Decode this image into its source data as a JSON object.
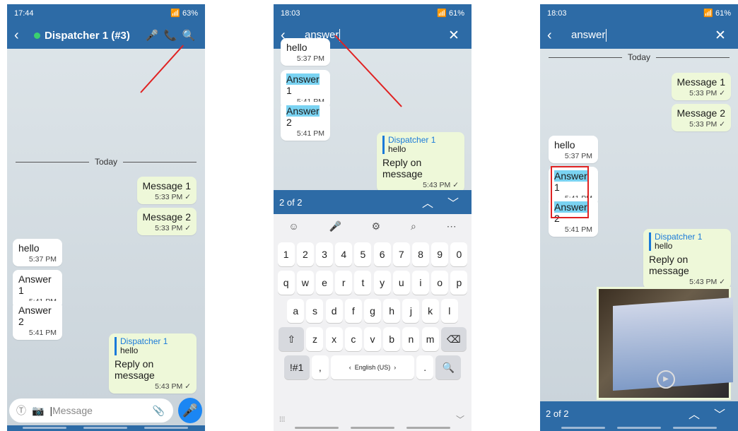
{
  "panel1": {
    "status": {
      "time": "17:44",
      "battery": "63%"
    },
    "appbar": {
      "title": "Dispatcher 1 (#3)"
    },
    "composer": {
      "placeholder": "Message"
    },
    "date_divider": "Today",
    "messages": [
      {
        "text": "Message 1",
        "time": "5:33 PM ✓"
      },
      {
        "text": "Message 2",
        "time": "5:33 PM ✓"
      },
      {
        "text": "hello",
        "time": "5:37 PM"
      },
      {
        "text": "Answer 1",
        "time": "5:41 PM"
      },
      {
        "text": "Answer 2",
        "time": "5:41 PM"
      },
      {
        "quote_name": "Dispatcher 1",
        "quote_text": "hello",
        "text": "Reply on message",
        "time": "5:43 PM ✓"
      }
    ]
  },
  "panel2": {
    "status": {
      "time": "18:03",
      "battery": "61%"
    },
    "search": {
      "query": "answer"
    },
    "messages": [
      {
        "text": "hello",
        "time": "5:37 PM"
      },
      {
        "hl": "Answer",
        "rest": " 1",
        "time": "5:41 PM"
      },
      {
        "hl": "Answer",
        "rest": " 2",
        "time": "5:41 PM"
      },
      {
        "quote_name": "Dispatcher 1",
        "quote_text": "hello",
        "text": "Reply on message",
        "time": "5:43 PM ✓"
      }
    ],
    "result_count": "2 of 2",
    "keyboard": {
      "row1": [
        "1",
        "2",
        "3",
        "4",
        "5",
        "6",
        "7",
        "8",
        "9",
        "0"
      ],
      "row2": [
        "q",
        "w",
        "e",
        "r",
        "t",
        "y",
        "u",
        "i",
        "o",
        "p"
      ],
      "row3": [
        "a",
        "s",
        "d",
        "f",
        "g",
        "h",
        "j",
        "k",
        "l"
      ],
      "row4": [
        "z",
        "x",
        "c",
        "v",
        "b",
        "n",
        "m"
      ],
      "sym": "!#1",
      "comma": ",",
      "lang": "English (US)",
      "period": "."
    }
  },
  "panel3": {
    "status": {
      "time": "18:03",
      "battery": "61%"
    },
    "search": {
      "query": "answer"
    },
    "date_divider": "Today",
    "messages": [
      {
        "text": "Message 1",
        "time": "5:33 PM ✓"
      },
      {
        "text": "Message 2",
        "time": "5:33 PM ✓"
      },
      {
        "text": "hello",
        "time": "5:37 PM"
      },
      {
        "hl": "Answer",
        "rest": " 1",
        "time": "5:41 PM"
      },
      {
        "hl": "Answer",
        "rest": " 2",
        "time": "5:41 PM"
      },
      {
        "quote_name": "Dispatcher 1",
        "quote_text": "hello",
        "text": "Reply on message",
        "time": "5:43 PM ✓"
      }
    ],
    "result_count": "2 of 2"
  },
  "colors": {
    "appbar": "#2d6ba6",
    "highlight": "#7ad3f2",
    "annotation": "#e02222",
    "outgoing": "#eef8d9"
  }
}
